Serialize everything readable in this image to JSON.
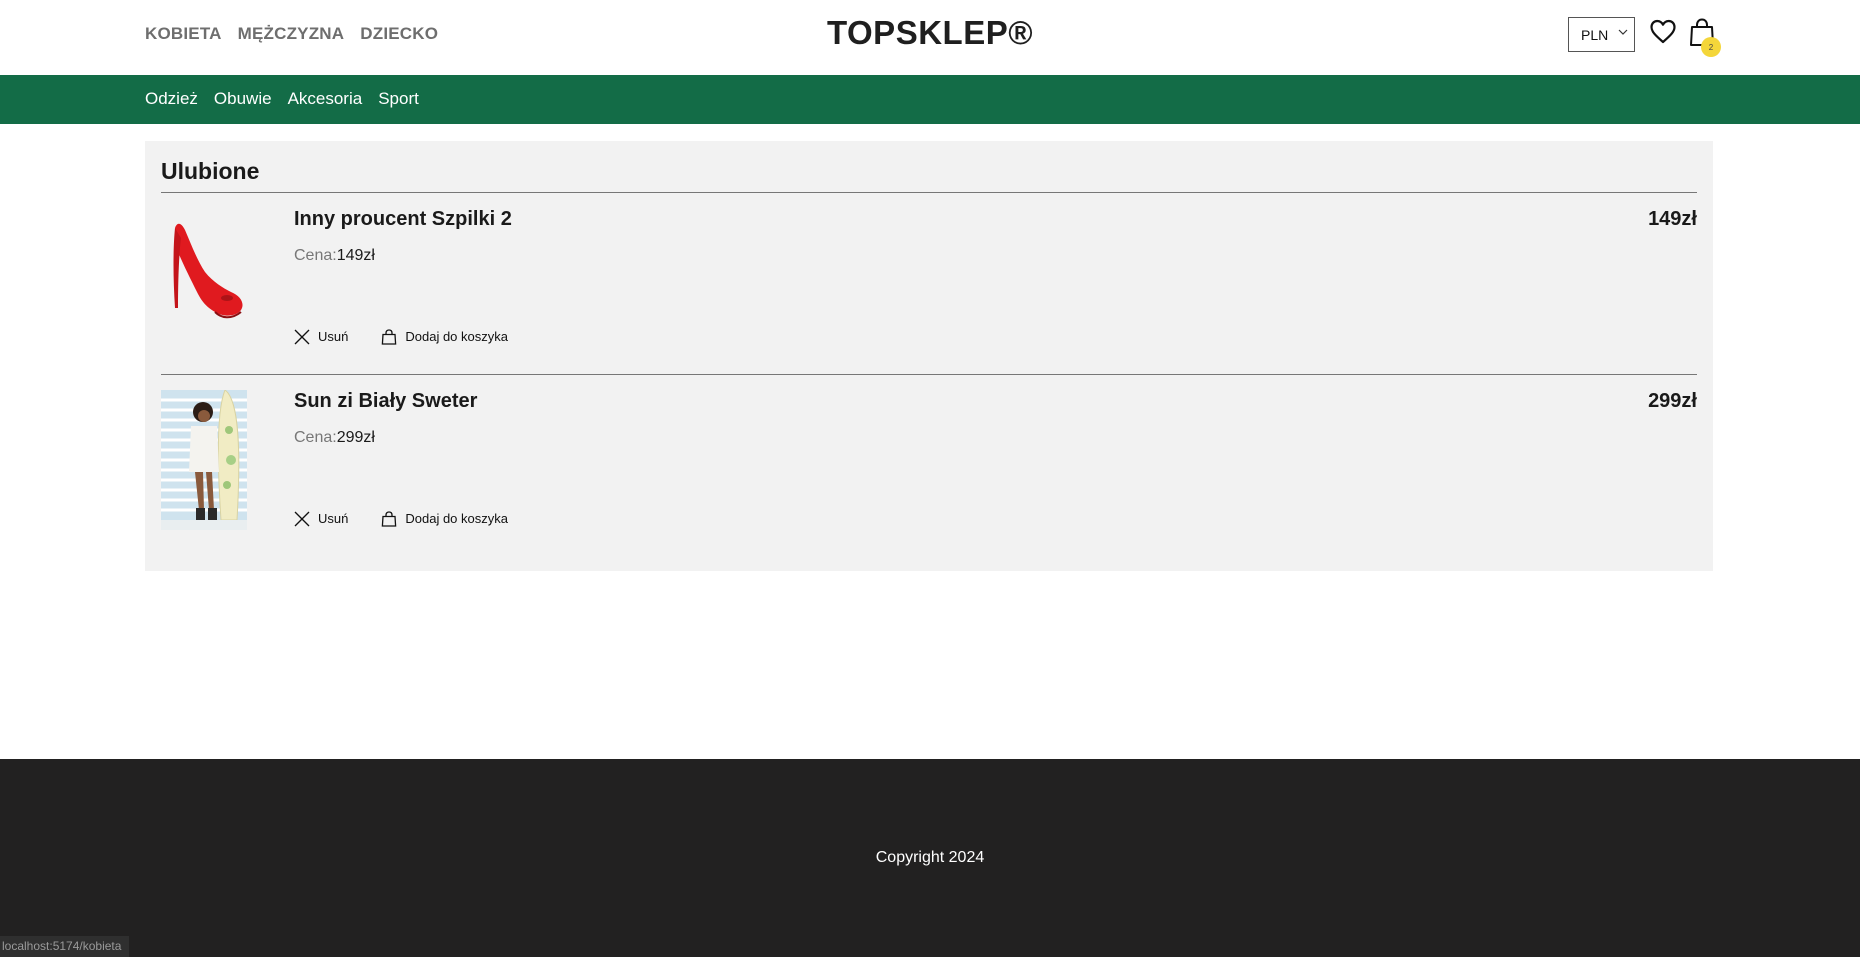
{
  "header": {
    "gender_nav": [
      "KOBIETA",
      "MĘŻCZYZNA",
      "DZIECKO"
    ],
    "logo": "TOPSKLEP®",
    "currency": "PLN",
    "cart_count": "2"
  },
  "categories": [
    "Odzież",
    "Obuwie",
    "Akcesoria",
    "Sport"
  ],
  "favorites": {
    "title": "Ulubione",
    "price_label": "Cena:",
    "remove_label": "Usuń",
    "add_to_cart_label": "Dodaj do koszyka",
    "items": [
      {
        "name": "Inny proucent Szpilki 2",
        "price": "149zł",
        "total": "149zł"
      },
      {
        "name": "Sun zi Biały Sweter",
        "price": "299zł",
        "total": "299zł"
      }
    ]
  },
  "footer": {
    "copyright": "Copyright 2024"
  },
  "status_url": "localhost:5174/kobieta",
  "colors": {
    "category_bar": "#136c47",
    "footer": "#222121",
    "badge": "#f4d63a",
    "panel": "#f2f2f2"
  }
}
